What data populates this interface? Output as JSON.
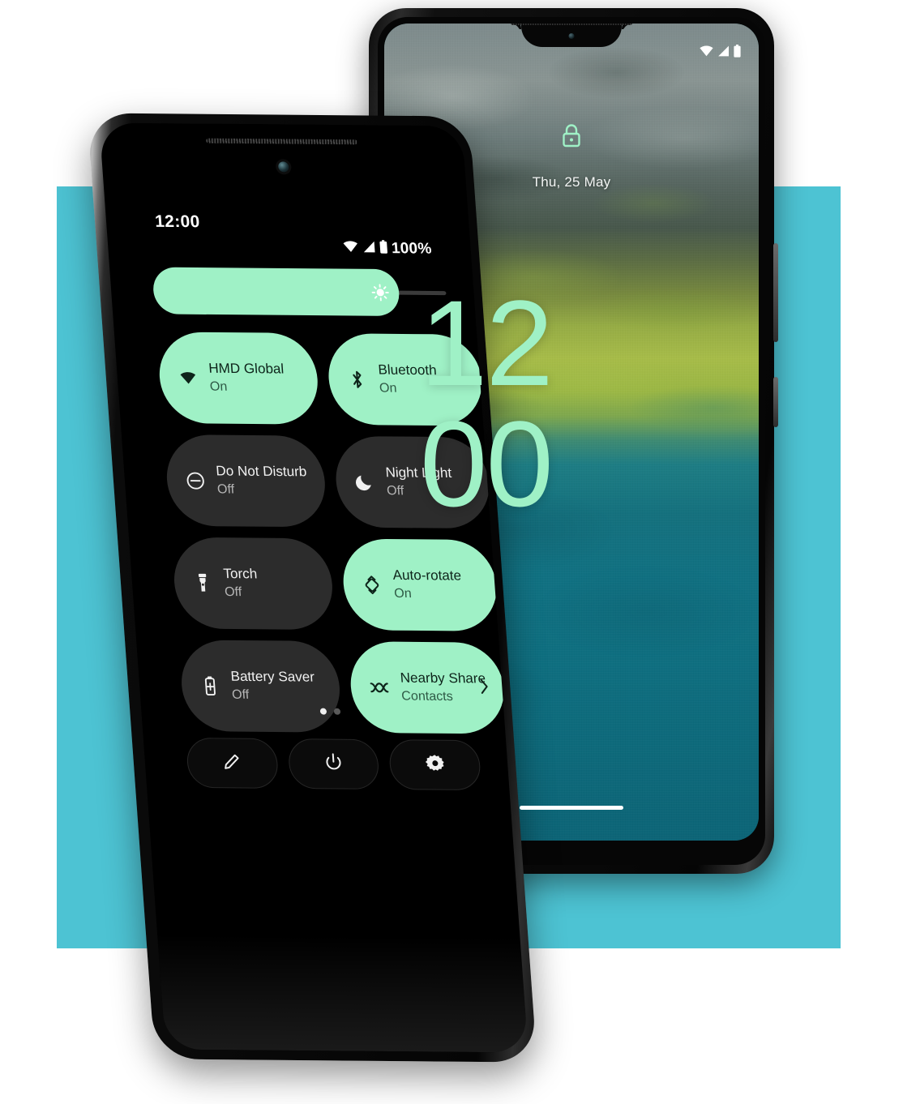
{
  "theme": {
    "backdrop_teal": "#4dc3d3",
    "accent_mint": "#9ff1c6",
    "tile_off_bg": "#2c2c2c",
    "screen_black": "#000000",
    "page_bg": "#ffffff"
  },
  "lock_phone": {
    "name": "lock-screen-phone",
    "status_bar": {
      "icons": [
        "wifi-icon",
        "cellular-signal-icon",
        "battery-icon"
      ]
    },
    "lock_icon": "lock-icon",
    "date": "Thu, 25 May",
    "clock": {
      "hours": "12",
      "minutes": "00"
    },
    "home_indicator": "home-indicator",
    "wallpaper": "aerial-shoreline-wallpaper",
    "side_buttons": [
      "volume-rocker",
      "power-button"
    ]
  },
  "qs_phone": {
    "name": "quick-settings-phone",
    "status_bar": {
      "clock": "12:00",
      "battery_percent": "100%",
      "icons": [
        "wifi-icon",
        "cellular-signal-icon",
        "battery-icon"
      ]
    },
    "brightness": {
      "label": "brightness-slider",
      "icon": "brightness-icon",
      "value_percent": 84
    },
    "tiles": [
      {
        "label": "HMD Global",
        "state": "On",
        "icon": "wifi-icon",
        "active": true,
        "chevron": false
      },
      {
        "label": "Bluetooth",
        "state": "On",
        "icon": "bluetooth-icon",
        "active": true,
        "chevron": false
      },
      {
        "label": "Do Not Disturb",
        "state": "Off",
        "icon": "do-not-disturb-icon",
        "active": false,
        "chevron": false
      },
      {
        "label": "Night Light",
        "state": "Off",
        "icon": "moon-icon",
        "active": false,
        "chevron": false
      },
      {
        "label": "Torch",
        "state": "Off",
        "icon": "flashlight-icon",
        "active": false,
        "chevron": false
      },
      {
        "label": "Auto-rotate",
        "state": "On",
        "icon": "auto-rotate-icon",
        "active": true,
        "chevron": false
      },
      {
        "label": "Battery Saver",
        "state": "Off",
        "icon": "battery-saver-icon",
        "active": false,
        "chevron": false
      },
      {
        "label": "Nearby Share",
        "state": "Contacts",
        "icon": "nearby-share-icon",
        "active": true,
        "chevron": true
      }
    ],
    "page_dots": {
      "count": 2,
      "active_index": 0
    },
    "footer_buttons": [
      {
        "name": "edit-tiles-button",
        "icon": "pencil-icon"
      },
      {
        "name": "power-menu-button",
        "icon": "power-icon"
      },
      {
        "name": "settings-button",
        "icon": "gear-icon"
      }
    ]
  }
}
